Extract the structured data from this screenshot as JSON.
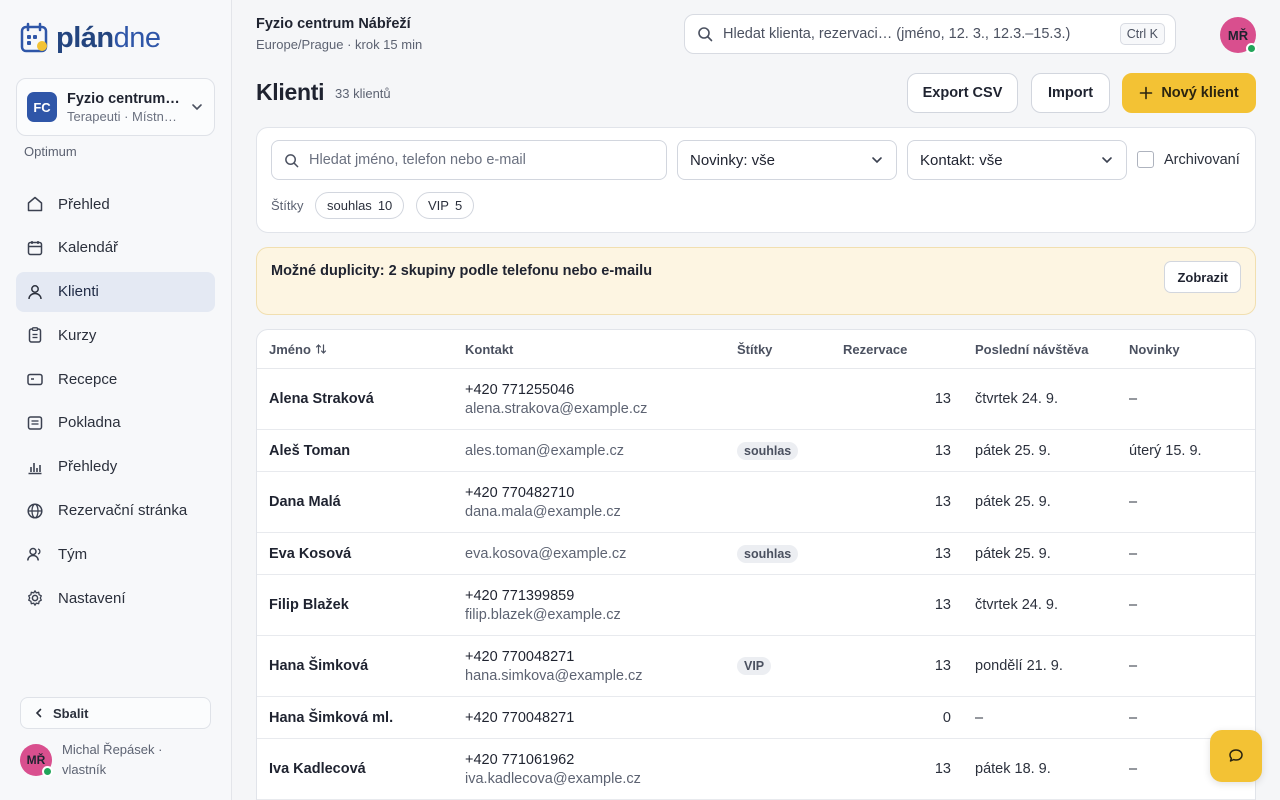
{
  "brand": {
    "logo_bold": "plán",
    "logo_light": "dne"
  },
  "org": {
    "badge": "FC",
    "name": "Fyzio centrum Nábřeží",
    "sub": "Terapeuti · Místnosti",
    "plan": "Optimum"
  },
  "nav": [
    {
      "label": "Přehled",
      "icon": "home-icon"
    },
    {
      "label": "Kalendář",
      "icon": "calendar-icon"
    },
    {
      "label": "Klienti",
      "icon": "user-icon",
      "active": true
    },
    {
      "label": "Kurzy",
      "icon": "clipboard-icon"
    },
    {
      "label": "Recepce",
      "icon": "card-icon"
    },
    {
      "label": "Pokladna",
      "icon": "receipt-icon"
    },
    {
      "label": "Přehledy",
      "icon": "bar-chart-icon"
    },
    {
      "label": "Rezervační stránka",
      "icon": "globe-icon"
    },
    {
      "label": "Tým",
      "icon": "team-icon"
    },
    {
      "label": "Nastavení",
      "icon": "gear-icon"
    }
  ],
  "sidebar": {
    "collapse_label": "Sbalit",
    "user_initials": "MŘ",
    "user_name": "Michal Řepásek · vlastník"
  },
  "header": {
    "title": "Fyzio centrum Nábřeží",
    "subtitle": "Europe/Prague · krok 15 min",
    "search_placeholder": "Hledat klienta, rezervaci… (jméno, 12. 3., 12.3.–15.3.)",
    "shortcut": "Ctrl K",
    "avatar_initials": "MŘ"
  },
  "page": {
    "title": "Klienti",
    "count": "33 klientů",
    "export_label": "Export CSV",
    "import_label": "Import",
    "new_label": "Nový klient"
  },
  "filters": {
    "search_placeholder": "Hledat jméno, telefon nebo e-mail",
    "newsletter": "Novinky: vše",
    "contact": "Kontakt: vše",
    "archived_label": "Archivovaní",
    "tags_label": "Štítky",
    "tags": [
      {
        "name": "souhlas",
        "count": "10"
      },
      {
        "name": "VIP",
        "count": "5"
      }
    ]
  },
  "duplicates": {
    "text": "Možné duplicity: 2 skupiny podle telefonu nebo e-mailu",
    "button": "Zobrazit"
  },
  "table": {
    "columns": [
      "Jméno",
      "Kontakt",
      "Štítky",
      "Rezervace",
      "Poslední návštěva",
      "Novinky"
    ],
    "rows": [
      {
        "name": "Alena Straková",
        "phone": "+420 771255046",
        "email": "alena.strakova@example.cz",
        "tag": "",
        "reservations": "13",
        "last_visit": "čtvrtek 24. 9.",
        "newsletter": "–"
      },
      {
        "name": "Aleš Toman",
        "phone": "",
        "email": "ales.toman@example.cz",
        "tag": "souhlas",
        "reservations": "13",
        "last_visit": "pátek 25. 9.",
        "newsletter": "úterý 15. 9."
      },
      {
        "name": "Dana Malá",
        "phone": "+420 770482710",
        "email": "dana.mala@example.cz",
        "tag": "",
        "reservations": "13",
        "last_visit": "pátek 25. 9.",
        "newsletter": "–"
      },
      {
        "name": "Eva Kosová",
        "phone": "",
        "email": "eva.kosova@example.cz",
        "tag": "souhlas",
        "reservations": "13",
        "last_visit": "pátek 25. 9.",
        "newsletter": "–"
      },
      {
        "name": "Filip Blažek",
        "phone": "+420 771399859",
        "email": "filip.blazek@example.cz",
        "tag": "",
        "reservations": "13",
        "last_visit": "čtvrtek 24. 9.",
        "newsletter": "–"
      },
      {
        "name": "Hana Šimková",
        "phone": "+420 770048271",
        "email": "hana.simkova@example.cz",
        "tag": "VIP",
        "reservations": "13",
        "last_visit": "pondělí 21. 9.",
        "newsletter": "–"
      },
      {
        "name": "Hana Šimková ml.",
        "phone": "+420 770048271",
        "email": "",
        "tag": "",
        "reservations": "0",
        "last_visit": "–",
        "newsletter": "–"
      },
      {
        "name": "Iva Kadlecová",
        "phone": "+420 771061962",
        "email": "iva.kadlecova@example.cz",
        "tag": "",
        "reservations": "13",
        "last_visit": "pátek 18. 9.",
        "newsletter": "–"
      }
    ]
  },
  "colors": {
    "accent": "#f3c234",
    "brand": "#2f56a8",
    "avatar": "#d94f8e",
    "online": "#22a55a"
  }
}
